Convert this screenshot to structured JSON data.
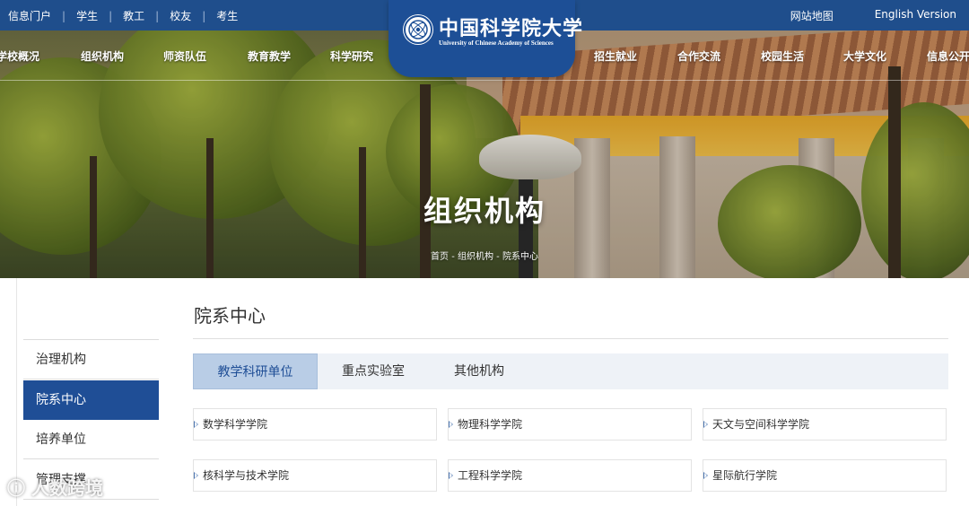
{
  "topbar": {
    "left_links": [
      "信息门户",
      "学生",
      "教工",
      "校友",
      "考生"
    ],
    "right_links": [
      "网站地图",
      "English Version"
    ]
  },
  "logo": {
    "name_cn": "中国科学院大学",
    "name_en": "University of Chinese Academy of Sciences"
  },
  "main_nav": [
    "学校概况",
    "组织机构",
    "师资队伍",
    "教育教学",
    "科学研究",
    "招生就业",
    "合作交流",
    "校园生活",
    "大学文化",
    "信息公开"
  ],
  "hero": {
    "title": "组织机构",
    "breadcrumb": [
      "首页",
      "组织机构",
      "院系中心"
    ],
    "breadcrumb_sep": " - "
  },
  "sidebar": {
    "items": [
      {
        "label": "治理机构",
        "active": false
      },
      {
        "label": "院系中心",
        "active": true
      },
      {
        "label": "培养单位",
        "active": false
      },
      {
        "label": "管理支撑",
        "active": false
      }
    ]
  },
  "content": {
    "title": "院系中心",
    "tabs": [
      {
        "label": "教学科研单位",
        "active": true
      },
      {
        "label": "重点实验室",
        "active": false
      },
      {
        "label": "其他机构",
        "active": false
      }
    ],
    "units": [
      "数学科学学院",
      "物理科学学院",
      "天文与空间科学学院",
      "核科学与技术学院",
      "工程科学学院",
      "星际航行学院"
    ]
  },
  "watermark": "人数跨境",
  "colors": {
    "brand_blue": "#1f4e8c",
    "active_sidebar": "#1f4e96",
    "active_tab_bg": "#b9cde6",
    "tabs_bg": "#eef2f7"
  }
}
